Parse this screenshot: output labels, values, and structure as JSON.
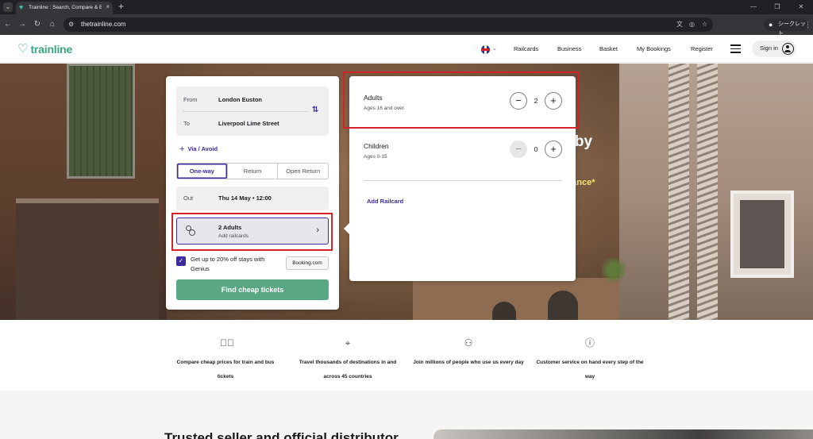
{
  "browser": {
    "tab_title": "Trainline : Search, Compare & B",
    "tab_close": "×",
    "new_tab": "+",
    "url": "thetrainline.com",
    "incognito_label": "シークレット",
    "icons": [
      "tab-search-icon",
      "back-icon",
      "forward-icon",
      "reload-icon",
      "home-icon",
      "site-info-icon",
      "translate-icon",
      "eye-off-icon",
      "star-icon",
      "incognito-icon",
      "more-icon"
    ]
  },
  "header": {
    "logo_text": "trainline",
    "nav": [
      "Railcards",
      "Business",
      "Basket",
      "My Bookings",
      "Register"
    ],
    "signin_label": "Sign in"
  },
  "hero": {
    "heading_fragment": "y by",
    "sub_fragment": "vance*"
  },
  "search": {
    "from_label": "From",
    "from_value": "London Euston",
    "to_label": "To",
    "to_value": "Liverpool Lime Street",
    "via_label": "Via / Avoid",
    "journey_types": [
      "One-way",
      "Return",
      "Open Return"
    ],
    "selected_journey": "One-way",
    "out_label": "Out",
    "out_value": "Thu 14 May • 12:00",
    "passengers_main": "2 Adults",
    "passengers_sub": "Add railcards",
    "genius_text": "Get up to 20% off stays with Genius",
    "booking_label": "Booking.com",
    "genius_checked": true,
    "find_button": "Find cheap tickets"
  },
  "passenger_popover": {
    "adults_title": "Adults",
    "adults_sub": "Ages 16 and over",
    "adults_count": "2",
    "children_title": "Children",
    "children_sub": "Ages 0-15",
    "children_count": "0",
    "add_railcard": "Add Railcard"
  },
  "features": [
    {
      "icon": "checkmark-circle-icon",
      "text": "Compare cheap prices for train and bus tickets"
    },
    {
      "icon": "map-pin-icon",
      "text": "Travel thousands of destinations in and across 45 countries"
    },
    {
      "icon": "people-icon",
      "text": "Join millions of people who use us every day"
    },
    {
      "icon": "info-icon",
      "text": "Customer service on hand every step of the way"
    }
  ],
  "lower": {
    "heading": "Trusted seller and official distributor"
  },
  "colors": {
    "brand_green": "#3aa57e",
    "accent_purple": "#3b2a9e",
    "button_green": "#5aa783",
    "annotation_red": "#d2232a"
  }
}
